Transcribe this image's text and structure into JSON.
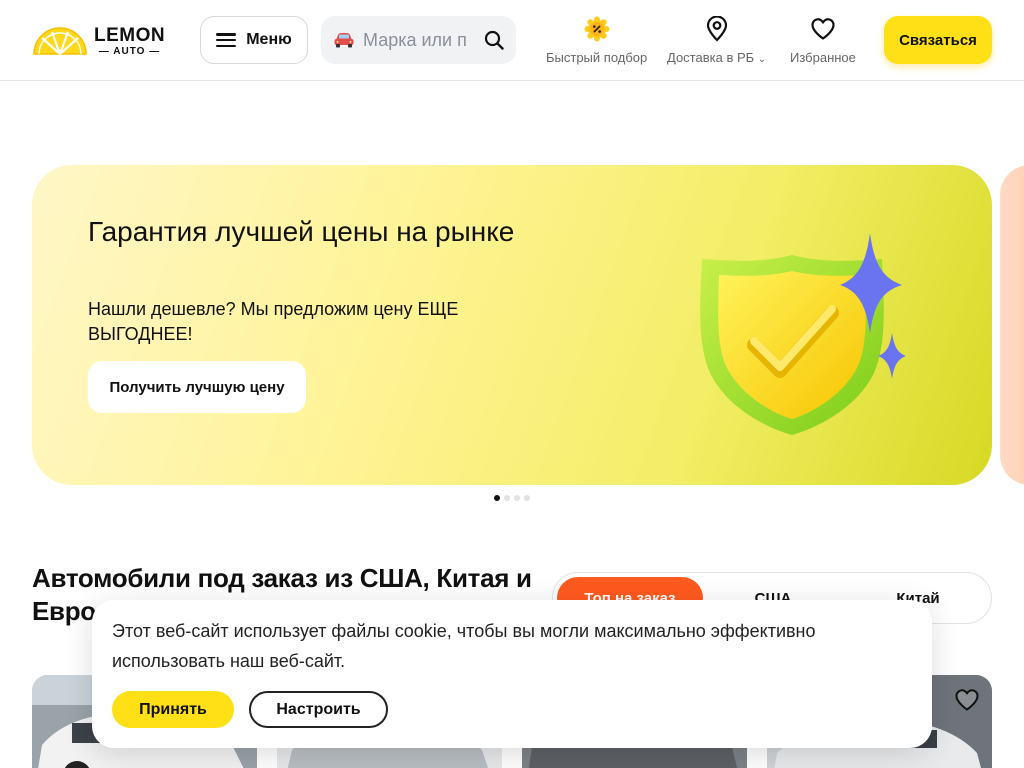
{
  "header": {
    "logo_main": "LEMON",
    "logo_sub": "AUTO",
    "menu_label": "Меню",
    "search_placeholder": "Марка или п",
    "nav": [
      {
        "label": "Быстрый подбор",
        "icon": "percent-badge-icon"
      },
      {
        "label": "Доставка в РБ",
        "icon": "map-pin-icon"
      },
      {
        "label": "Избранное",
        "icon": "heart-icon"
      }
    ],
    "contact_label": "Связаться"
  },
  "banner": {
    "title": "Гарантия лучшей цены на рынке",
    "subtitle": "Нашли дешевле? Мы предложим цену ЕЩЕ ВЫГОДНЕЕ!",
    "cta": "Получить лучшую цену",
    "slides_count": 4,
    "active_slide": 1
  },
  "section": {
    "title": "Автомобили под заказ из США, Китая и Евро",
    "tabs": [
      {
        "label": "Топ на заказ",
        "active": true
      },
      {
        "label": "США",
        "active": false
      },
      {
        "label": "Китай",
        "active": false
      }
    ]
  },
  "cookie": {
    "message": "Этот веб-сайт использует файлы cookie, чтобы вы могли максимально эффективно использовать наш веб-сайт.",
    "accept": "Принять",
    "configure": "Настроить"
  },
  "colors": {
    "accent_yellow": "#ffe016",
    "tab_active": "#ff5a1f"
  }
}
